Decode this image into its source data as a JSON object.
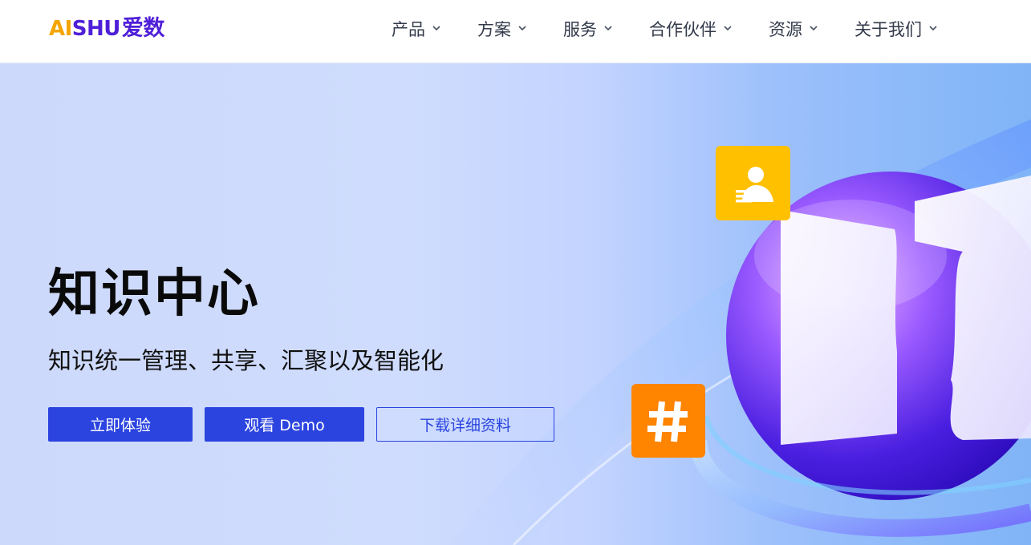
{
  "brand": {
    "logo_latin_a": "AI",
    "logo_latin_b": "SHU",
    "logo_cn": "爱数",
    "colors": {
      "orange": "#f5a500",
      "purple": "#4f1fd8"
    }
  },
  "nav": {
    "items": [
      {
        "label": "产品"
      },
      {
        "label": "方案"
      },
      {
        "label": "服务"
      },
      {
        "label": "合作伙伴"
      },
      {
        "label": "资源"
      },
      {
        "label": "关于我们"
      }
    ],
    "icon": "chevron-down-icon"
  },
  "hero": {
    "title": "知识中心",
    "subtitle": "知识统一管理、共享、汇聚以及智能化",
    "buttons": {
      "try": "立即体验",
      "demo": "观看 Demo",
      "download": "下载详细资料"
    },
    "accent_color": "#2b44e0",
    "icons": [
      "user-card-icon",
      "hashtag-icon",
      "sphere-illustration"
    ]
  }
}
